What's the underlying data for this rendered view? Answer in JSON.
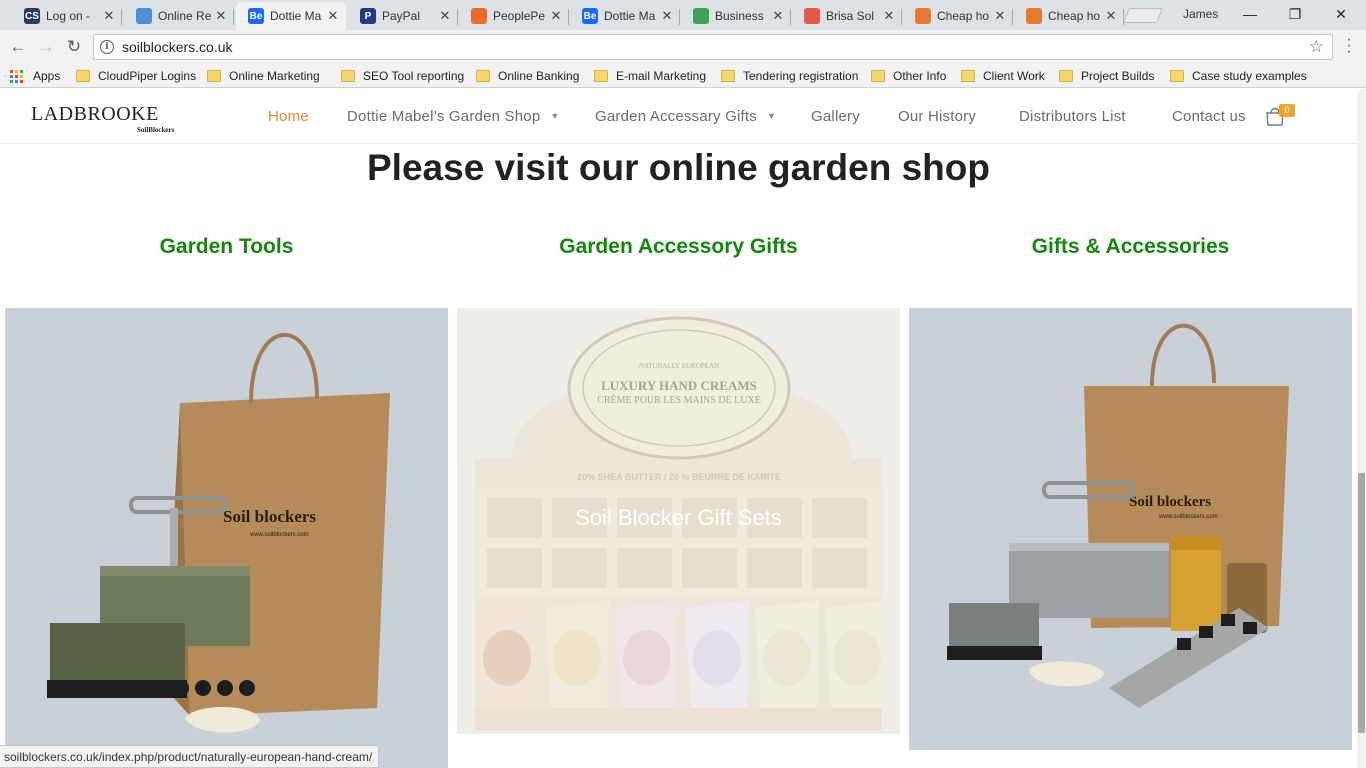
{
  "browser": {
    "tabs": [
      {
        "title": "Log on - ",
        "favicon": "cs-logo-icon",
        "color": "#2b3a55",
        "glyph": "CS"
      },
      {
        "title": "Online Re",
        "favicon": "blue-droplet-icon",
        "color": "#4a90d9",
        "glyph": ""
      },
      {
        "title": "Dottie Ma",
        "favicon": "behance-icon",
        "color": "#1769ff",
        "glyph": "Be"
      },
      {
        "title": "PayPal",
        "favicon": "paypal-icon",
        "color": "#253b80",
        "glyph": "P"
      },
      {
        "title": "PeoplePe",
        "favicon": "peopleperhour-icon",
        "color": "#e86b2b",
        "glyph": ""
      },
      {
        "title": "Dottie Ma",
        "favicon": "behance-icon",
        "color": "#1769ff",
        "glyph": "Be"
      },
      {
        "title": "Business",
        "favicon": "business-icon",
        "color": "#3aa655",
        "glyph": ""
      },
      {
        "title": "Brisa Sol",
        "favicon": "sun-icon",
        "color": "#e05a4a",
        "glyph": ""
      },
      {
        "title": "Cheap ho",
        "favicon": "tripadvisor-icon",
        "color": "#e97a2b",
        "glyph": ""
      },
      {
        "title": "Cheap ho",
        "favicon": "tripadvisor-icon",
        "color": "#e97a2b",
        "glyph": ""
      }
    ],
    "active_tab_index": 2,
    "profile_name": "James",
    "url": "soilblockers.co.uk",
    "bookmarks": [
      {
        "label": "Apps",
        "icon": "apps-grid-icon"
      },
      {
        "label": "CloudPiper Logins",
        "icon": "folder-icon"
      },
      {
        "label": "Online Marketing",
        "icon": "folder-icon"
      },
      {
        "label": "SEO Tool reporting",
        "icon": "folder-icon"
      },
      {
        "label": "Online Banking",
        "icon": "folder-icon"
      },
      {
        "label": "E-mail Marketing",
        "icon": "folder-icon"
      },
      {
        "label": "Tendering registration",
        "icon": "folder-icon"
      },
      {
        "label": "Other Info",
        "icon": "folder-icon"
      },
      {
        "label": "Client Work",
        "icon": "folder-icon"
      },
      {
        "label": "Project Builds",
        "icon": "folder-icon"
      },
      {
        "label": "Case study examples",
        "icon": "folder-icon"
      }
    ],
    "status_url": "soilblockers.co.uk/index.php/product/naturally-european-hand-cream/"
  },
  "site": {
    "logo_main": "LADBROOKE",
    "logo_sub": "SoilBlockers",
    "menu": [
      {
        "label": "Home",
        "dropdown": false
      },
      {
        "label": "Dottie Mabel’s Garden Shop",
        "dropdown": true
      },
      {
        "label": "Garden Accessary Gifts",
        "dropdown": true
      },
      {
        "label": "Gallery",
        "dropdown": false
      },
      {
        "label": "Our History",
        "dropdown": false
      },
      {
        "label": "Distributors List",
        "dropdown": false
      },
      {
        "label": "Contact us",
        "dropdown": false
      }
    ],
    "cart_count": "0",
    "headline": "Please visit our online garden shop",
    "categories": [
      "Garden Tools",
      "Garden Accessory Gifts",
      "Gifts & Accessories"
    ],
    "cards": [
      {
        "bag_brand": "Soil blockers",
        "bag_site": "www.soilblockers.com"
      },
      {
        "overlay": "Soil Blocker Gift Sets",
        "box_title_1": "LUXURY HAND CREAMS",
        "box_title_2": "CRÈME POUR LES MAINS DE LUXE",
        "box_strip": "20% SHEA BUTTER / 20 % BEURRE DE KARITÉ",
        "box_brand": "NATURALLY EUROPEAN"
      },
      {
        "bag_brand": "Soil blockers",
        "bag_site": "www.soilblockers.com"
      }
    ],
    "accent_color": "#e8872b",
    "category_color": "#15870f"
  }
}
